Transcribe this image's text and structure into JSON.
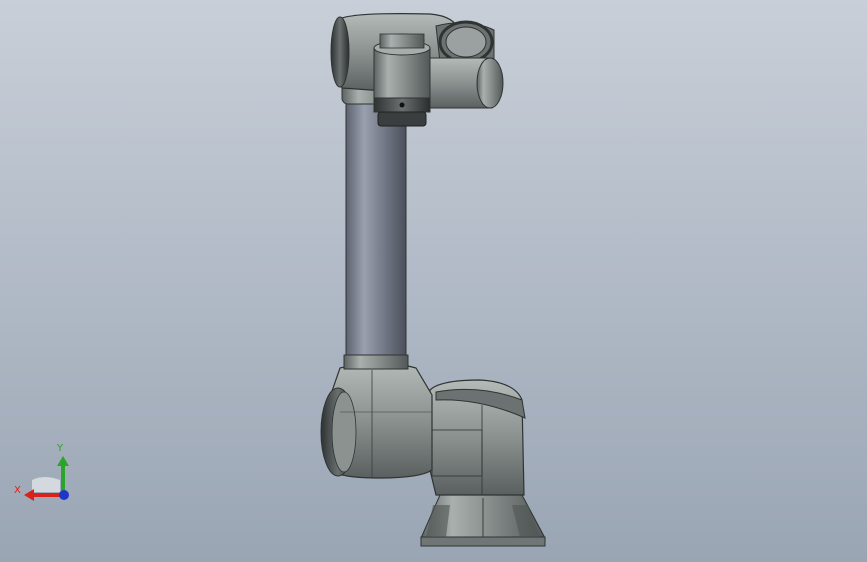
{
  "viewport": {
    "background_top": "#c9cfd8",
    "background_bottom": "#9aa5b4",
    "model": "robot-arm",
    "model_color": "#8e9593"
  },
  "triad": {
    "x_label": "X",
    "y_label": "Y",
    "x_color": "#d8231c",
    "y_color": "#2aa52a",
    "z_color": "#1f37c8"
  }
}
